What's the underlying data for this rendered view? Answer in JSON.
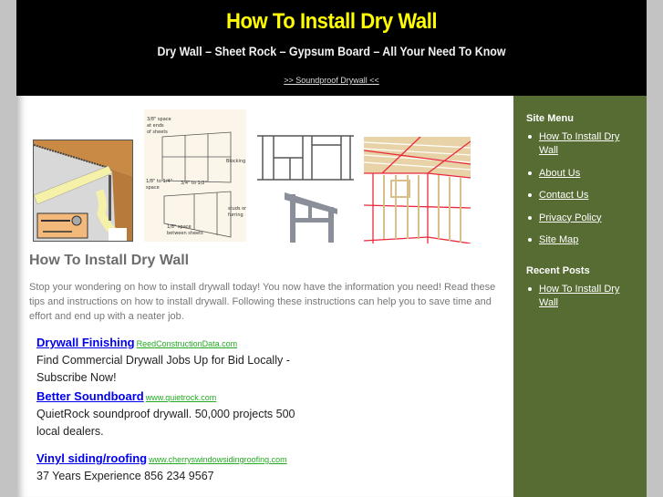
{
  "header": {
    "title": "How To Install Dry Wall",
    "tagline": "Dry Wall – Sheet Rock – Gypsum Board – All Your Need To Know",
    "link": ">> Soundproof Drywall <<"
  },
  "images": [
    {
      "name": "drywall-screw-diagram",
      "alt": "Drywall ceiling and screw installation diagram"
    },
    {
      "name": "drywall-sheet-spacing-diagram",
      "alt": "Drywall sheet spacing diagram"
    },
    {
      "name": "wall-framing-diagram",
      "alt": "Wall stud framing diagram"
    },
    {
      "name": "room-framing-illustration",
      "alt": "Room framing with red drywall seams"
    }
  ],
  "post": {
    "title": "How To Install Dry Wall",
    "body": "Stop your wondering on how to install drywall today! You now have the information you need! Read these tips and instructions on how to install drywall. Following these instructions can help you to save time and effort and end up with a neater job."
  },
  "ads": [
    {
      "title": "Drywall Finishing",
      "url": "ReedConstructionData.com",
      "desc": "Find Commercial Drywall Jobs Up for Bid Locally - Subscribe Now!"
    },
    {
      "title": "Better Soundboard",
      "url": "www.quietrock.com",
      "desc": "QuietRock soundproof drywall. 50,000 projects 500 local dealers."
    },
    {
      "title": "Vinyl siding/roofing",
      "url": "www.cherryswindowsidingroofing.com",
      "desc": "37 Years Experience 856 234 9567"
    }
  ],
  "sidebar": {
    "menu_heading": "Site Menu",
    "menu": [
      {
        "label": "How To Install Dry Wall"
      },
      {
        "label": "About Us"
      },
      {
        "label": "Contact Us"
      },
      {
        "label": "Privacy Policy"
      },
      {
        "label": "Site Map"
      }
    ],
    "recent_heading": "Recent Posts",
    "recent": [
      {
        "label": "How To Install Dry Wall"
      }
    ]
  },
  "colors": {
    "header_bg": "#000000",
    "title": "#ffff00",
    "sidebar_bg": "#566c33",
    "page_bg": "#c3c3c3",
    "ad_link": "#0000ee",
    "ad_url": "#22aa22"
  }
}
